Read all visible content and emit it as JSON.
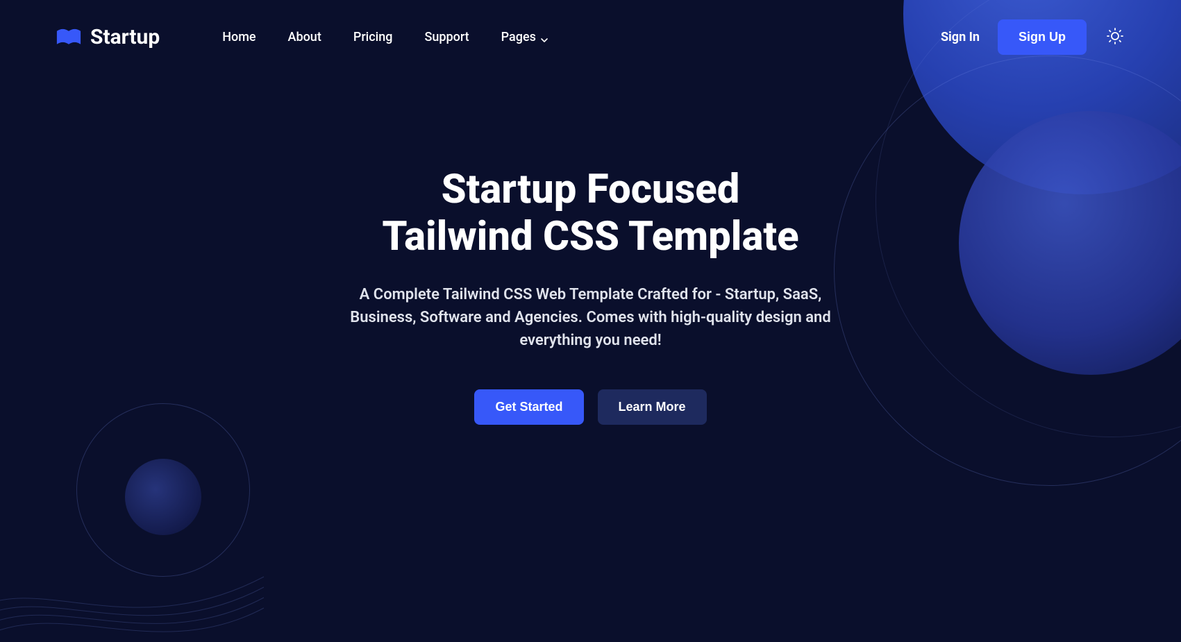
{
  "header": {
    "brand": "Startup",
    "nav": [
      {
        "label": "Home"
      },
      {
        "label": "About"
      },
      {
        "label": "Pricing"
      },
      {
        "label": "Support"
      },
      {
        "label": "Pages",
        "dropdown": true
      }
    ],
    "signin_label": "Sign In",
    "signup_label": "Sign Up"
  },
  "hero": {
    "title": "Startup Focused\nTailwind CSS Template",
    "subtitle": "A Complete Tailwind CSS Web Template Crafted for - Startup, SaaS, Business, Software and Agencies. Comes with high-quality design and everything you need!",
    "cta_primary": "Get Started",
    "cta_secondary": "Learn More"
  },
  "colors": {
    "bg": "#0a0f2c",
    "accent": "#3758F9",
    "btn_dark": "#1e2a5e"
  }
}
